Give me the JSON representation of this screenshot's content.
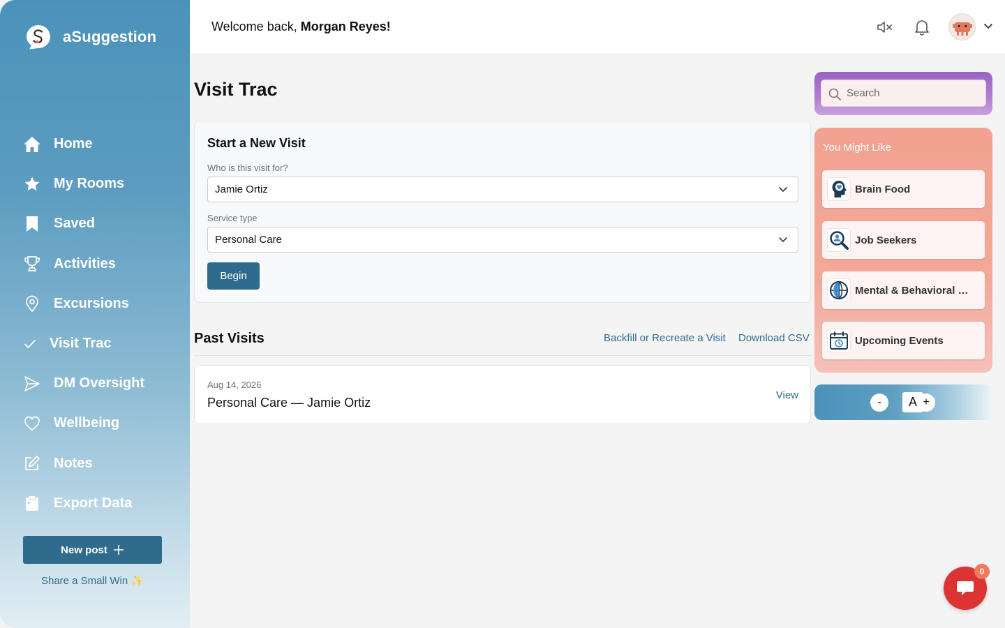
{
  "brand": {
    "name": "aSuggestion"
  },
  "header": {
    "welcome_prefix": "Welcome back, ",
    "user_name": "Morgan Reyes!"
  },
  "sidebar": {
    "items": [
      {
        "label": "Home",
        "icon": "home-icon"
      },
      {
        "label": "My Rooms",
        "icon": "star-icon"
      },
      {
        "label": "Saved",
        "icon": "bookmark-icon"
      },
      {
        "label": "Activities",
        "icon": "trophy-icon"
      },
      {
        "label": "Excursions",
        "icon": "location-pin-icon"
      },
      {
        "label": "Visit Trac",
        "icon": "checkmark-icon"
      },
      {
        "label": "DM Oversight",
        "icon": "send-icon"
      },
      {
        "label": "Wellbeing",
        "icon": "heart-icon"
      },
      {
        "label": "Notes",
        "icon": "edit-icon"
      },
      {
        "label": "Export Data",
        "icon": "clipboard-icon"
      }
    ],
    "active_item": "Visit Trac",
    "new_post_label": "New post",
    "small_win_label": "Share a Small Win ✨"
  },
  "main": {
    "title": "Visit Trac",
    "new_visit": {
      "title": "Start a New Visit",
      "who_label": "Who is this visit for?",
      "who_value": "Jamie Ortiz",
      "service_label": "Service type",
      "service_value": "Personal Care",
      "begin_label": "Begin"
    },
    "past_visits": {
      "title": "Past Visits",
      "backfill_link": "Backfill or Recreate a Visit",
      "download_link": "Download CSV",
      "rows": [
        {
          "date": "Aug 14, 2026",
          "name": "Personal Care — Jamie Ortiz",
          "action": "View"
        }
      ]
    }
  },
  "right": {
    "search_placeholder": "Search",
    "you_might_like": {
      "title": "You Might Like",
      "items": [
        {
          "label": "Brain Food",
          "icon": "brain-head-icon"
        },
        {
          "label": "Job Seekers",
          "icon": "magnify-person-icon"
        },
        {
          "label": "Mental & Behavioral Health",
          "icon": "globe-brain-icon"
        },
        {
          "label": "Upcoming Events",
          "icon": "calendar-icon"
        }
      ]
    },
    "font_size": {
      "decrease": "-",
      "label": "A",
      "increase": "+"
    }
  },
  "chat": {
    "badge_count": "0"
  },
  "colors": {
    "accent": "#2f6b8d",
    "sidebar_top": "#4b92b9",
    "chat_red": "#dc3432",
    "like_panel": "#f2a28f",
    "search_panel": "#9a63c4"
  }
}
